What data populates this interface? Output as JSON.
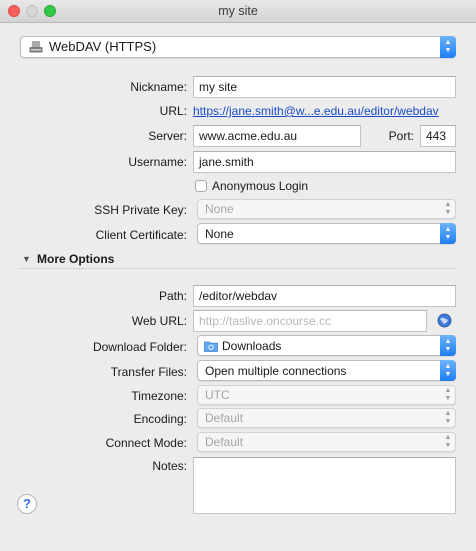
{
  "window": {
    "title": "my site"
  },
  "protocol": {
    "selected": "WebDAV (HTTPS)",
    "icon": "drive-icon"
  },
  "nickname": {
    "label": "Nickname:",
    "value": "my site"
  },
  "url": {
    "label": "URL:",
    "value": "https://jane.smith@w...e.edu.au/editor/webdav"
  },
  "server": {
    "label": "Server:",
    "value": "www.acme.edu.au"
  },
  "port": {
    "label": "Port:",
    "value": "443"
  },
  "username": {
    "label": "Username:",
    "value": "jane.smith"
  },
  "anonymous": {
    "label": "Anonymous Login",
    "checked": false
  },
  "ssh_key": {
    "label": "SSH Private Key:",
    "value": "None",
    "disabled": true
  },
  "client_cert": {
    "label": "Client Certificate:",
    "value": "None"
  },
  "more_options": {
    "label": "More Options",
    "expanded": true
  },
  "path": {
    "label": "Path:",
    "value": "/editor/webdav"
  },
  "web_url": {
    "label": "Web URL:",
    "placeholder": "http://taslive.oncourse.cc"
  },
  "download_folder": {
    "label": "Download Folder:",
    "value": "Downloads",
    "icon": "folder-icon"
  },
  "transfer_files": {
    "label": "Transfer Files:",
    "value": "Open multiple connections"
  },
  "timezone": {
    "label": "Timezone:",
    "value": "UTC",
    "disabled": true
  },
  "encoding": {
    "label": "Encoding:",
    "value": "Default",
    "disabled": true
  },
  "connect_mode": {
    "label": "Connect Mode:",
    "value": "Default",
    "disabled": true
  },
  "notes": {
    "label": "Notes:",
    "value": ""
  },
  "help": {
    "label": "?"
  },
  "colors": {
    "accent": "#1e7ef4",
    "link": "#1a4cc8"
  }
}
